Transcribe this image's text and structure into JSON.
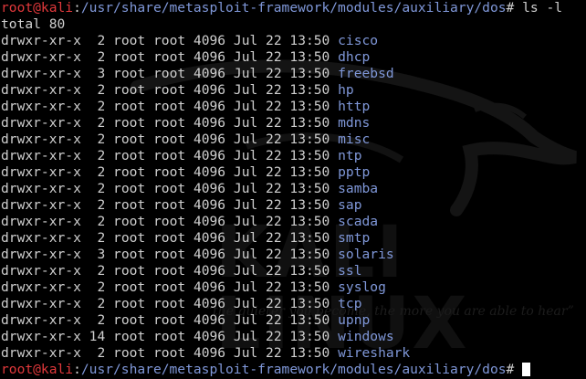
{
  "prompt": {
    "user_host": "root@kali",
    "separator": ":",
    "path": "/usr/share/metasploit-framework/modules/auxiliary/dos",
    "symbol": "#"
  },
  "command": " ls -l",
  "total": "total 80",
  "entries": [
    {
      "perm": "drwxr-xr-x",
      "links": " 2",
      "owner": "root",
      "group": "root",
      "size": "4096",
      "date": "Jul 22 13:50",
      "name": "cisco"
    },
    {
      "perm": "drwxr-xr-x",
      "links": " 2",
      "owner": "root",
      "group": "root",
      "size": "4096",
      "date": "Jul 22 13:50",
      "name": "dhcp"
    },
    {
      "perm": "drwxr-xr-x",
      "links": " 3",
      "owner": "root",
      "group": "root",
      "size": "4096",
      "date": "Jul 22 13:50",
      "name": "freebsd"
    },
    {
      "perm": "drwxr-xr-x",
      "links": " 2",
      "owner": "root",
      "group": "root",
      "size": "4096",
      "date": "Jul 22 13:50",
      "name": "hp"
    },
    {
      "perm": "drwxr-xr-x",
      "links": " 2",
      "owner": "root",
      "group": "root",
      "size": "4096",
      "date": "Jul 22 13:50",
      "name": "http"
    },
    {
      "perm": "drwxr-xr-x",
      "links": " 2",
      "owner": "root",
      "group": "root",
      "size": "4096",
      "date": "Jul 22 13:50",
      "name": "mdns"
    },
    {
      "perm": "drwxr-xr-x",
      "links": " 2",
      "owner": "root",
      "group": "root",
      "size": "4096",
      "date": "Jul 22 13:50",
      "name": "misc"
    },
    {
      "perm": "drwxr-xr-x",
      "links": " 2",
      "owner": "root",
      "group": "root",
      "size": "4096",
      "date": "Jul 22 13:50",
      "name": "ntp"
    },
    {
      "perm": "drwxr-xr-x",
      "links": " 2",
      "owner": "root",
      "group": "root",
      "size": "4096",
      "date": "Jul 22 13:50",
      "name": "pptp"
    },
    {
      "perm": "drwxr-xr-x",
      "links": " 2",
      "owner": "root",
      "group": "root",
      "size": "4096",
      "date": "Jul 22 13:50",
      "name": "samba"
    },
    {
      "perm": "drwxr-xr-x",
      "links": " 2",
      "owner": "root",
      "group": "root",
      "size": "4096",
      "date": "Jul 22 13:50",
      "name": "sap"
    },
    {
      "perm": "drwxr-xr-x",
      "links": " 2",
      "owner": "root",
      "group": "root",
      "size": "4096",
      "date": "Jul 22 13:50",
      "name": "scada"
    },
    {
      "perm": "drwxr-xr-x",
      "links": " 2",
      "owner": "root",
      "group": "root",
      "size": "4096",
      "date": "Jul 22 13:50",
      "name": "smtp"
    },
    {
      "perm": "drwxr-xr-x",
      "links": " 3",
      "owner": "root",
      "group": "root",
      "size": "4096",
      "date": "Jul 22 13:50",
      "name": "solaris"
    },
    {
      "perm": "drwxr-xr-x",
      "links": " 2",
      "owner": "root",
      "group": "root",
      "size": "4096",
      "date": "Jul 22 13:50",
      "name": "ssl"
    },
    {
      "perm": "drwxr-xr-x",
      "links": " 2",
      "owner": "root",
      "group": "root",
      "size": "4096",
      "date": "Jul 22 13:50",
      "name": "syslog"
    },
    {
      "perm": "drwxr-xr-x",
      "links": " 2",
      "owner": "root",
      "group": "root",
      "size": "4096",
      "date": "Jul 22 13:50",
      "name": "tcp"
    },
    {
      "perm": "drwxr-xr-x",
      "links": " 2",
      "owner": "root",
      "group": "root",
      "size": "4096",
      "date": "Jul 22 13:50",
      "name": "upnp"
    },
    {
      "perm": "drwxr-xr-x",
      "links": "14",
      "owner": "root",
      "group": "root",
      "size": "4096",
      "date": "Jul 22 13:50",
      "name": "windows"
    },
    {
      "perm": "drwxr-xr-x",
      "links": " 2",
      "owner": "root",
      "group": "root",
      "size": "4096",
      "date": "Jul 22 13:50",
      "name": "wireshark"
    }
  ],
  "wallpaper": {
    "brand": "KALI LINUX",
    "tagline": "“the quieter you become, the more you are able to hear”"
  },
  "colors": {
    "background": "#000000",
    "text": "#cfcfcf",
    "prompt_user": "#e0383b",
    "prompt_path": "#7f97d8",
    "directory": "#7f97d8"
  }
}
